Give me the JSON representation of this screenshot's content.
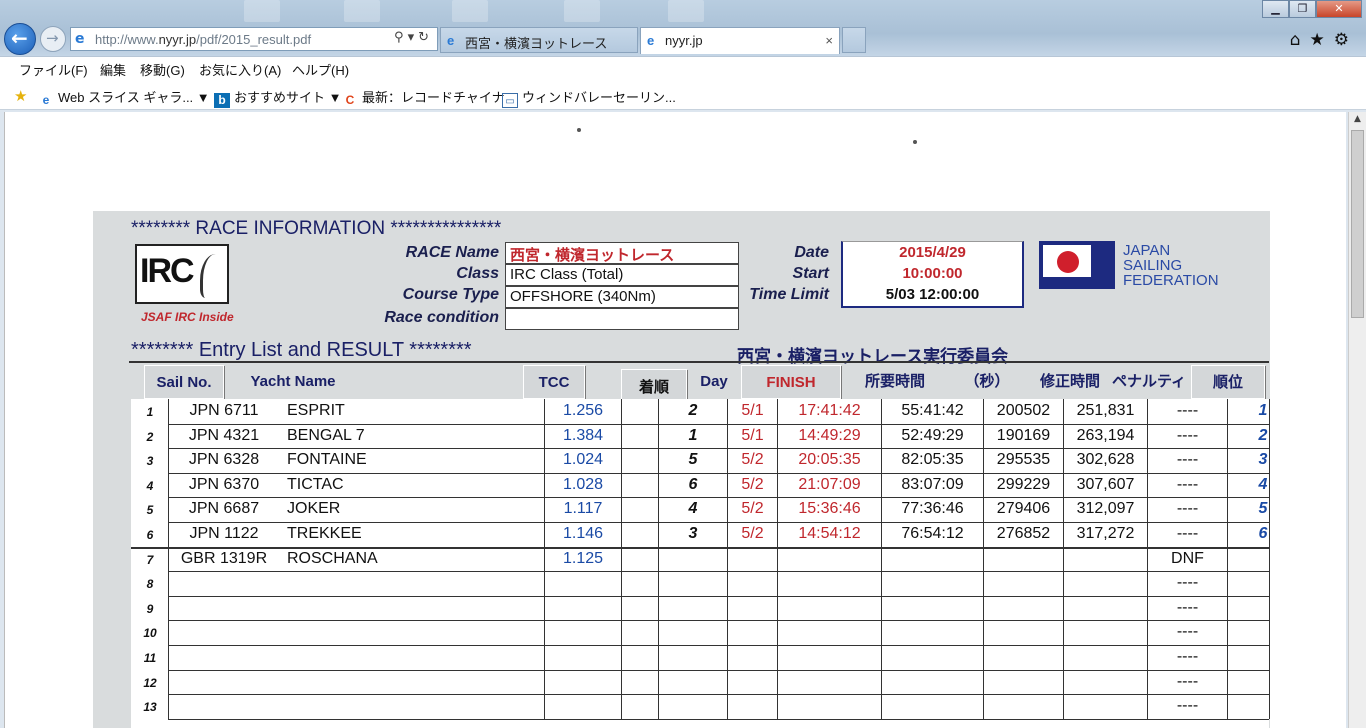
{
  "browser": {
    "address": {
      "prefix": "http://www.",
      "host": "nyyr.jp",
      "path": "/pdf/2015_result.pdf"
    },
    "tabs": [
      {
        "label": "西宮・横濱ヨットレース"
      },
      {
        "label": "nyyr.jp",
        "close": "×"
      }
    ],
    "menu": [
      "ファイル(F)",
      "編集",
      "移動(G)",
      "お気に入り(A)",
      "ヘルプ(H)"
    ],
    "favorites": [
      "Web スライス ギャラ...",
      "おすすめサイト",
      "最新：レコードチャイナ",
      "ウィンドバレーセーリン..."
    ]
  },
  "document": {
    "race_info_heading": "********  RACE INFORMATION  ***************",
    "irc_logo": "IRC",
    "jsaf_tagline": "JSAF IRC Inside",
    "labels": {
      "race_name": "RACE Name",
      "class": "Class",
      "course_type": "Course Type",
      "race_condition": "Race condition",
      "date": "Date",
      "start": "Start",
      "time_limit": "Time Limit"
    },
    "values": {
      "race_name": "西宮・横濱ヨットレース",
      "class": "IRC  Class (Total)",
      "course_type": "OFFSHORE (340Nm)",
      "race_condition": "",
      "date": "2015/4/29",
      "start": "10:00:00",
      "time_limit": "5/03 12:00:00"
    },
    "federation_lines": [
      "JAPAN",
      "SAILING",
      "FEDERATION"
    ],
    "entry_heading": "********  Entry List  and  RESULT  ********",
    "committee": "西宮・横濱ヨットレース実行委員会",
    "headers": {
      "sail_no": "Sail No.",
      "yacht_name": "Yacht Name",
      "tcc": "TCC",
      "finish_order": "着順",
      "day": "Day",
      "finish": "FINISH",
      "elapsed": "所要時間",
      "seconds": "（秒）",
      "corrected": "修正時間",
      "penalty": "ペナルティ",
      "rank": "順位"
    },
    "rows": [
      {
        "num": "1",
        "sail": "JPN 6711",
        "yacht": "ESPRIT",
        "tcc": "1.256",
        "order": "2",
        "day": "5/1",
        "finish": "17:41:42",
        "elapsed": "55:41:42",
        "sec": "200502",
        "corrected": "251,831",
        "penalty": "----",
        "rank": "1"
      },
      {
        "num": "2",
        "sail": "JPN 4321",
        "yacht": "BENGAL 7",
        "tcc": "1.384",
        "order": "1",
        "day": "5/1",
        "finish": "14:49:29",
        "elapsed": "52:49:29",
        "sec": "190169",
        "corrected": "263,194",
        "penalty": "----",
        "rank": "2"
      },
      {
        "num": "3",
        "sail": "JPN 6328",
        "yacht": "FONTAINE",
        "tcc": "1.024",
        "order": "5",
        "day": "5/2",
        "finish": "20:05:35",
        "elapsed": "82:05:35",
        "sec": "295535",
        "corrected": "302,628",
        "penalty": "----",
        "rank": "3"
      },
      {
        "num": "4",
        "sail": "JPN 6370",
        "yacht": "TICTAC",
        "tcc": "1.028",
        "order": "6",
        "day": "5/2",
        "finish": "21:07:09",
        "elapsed": "83:07:09",
        "sec": "299229",
        "corrected": "307,607",
        "penalty": "----",
        "rank": "4"
      },
      {
        "num": "5",
        "sail": "JPN 6687",
        "yacht": "JOKER",
        "tcc": "1.117",
        "order": "4",
        "day": "5/2",
        "finish": "15:36:46",
        "elapsed": "77:36:46",
        "sec": "279406",
        "corrected": "312,097",
        "penalty": "----",
        "rank": "5"
      },
      {
        "num": "6",
        "sail": "JPN 1122",
        "yacht": "TREKKEE",
        "tcc": "1.146",
        "order": "3",
        "day": "5/2",
        "finish": "14:54:12",
        "elapsed": "76:54:12",
        "sec": "276852",
        "corrected": "317,272",
        "penalty": "----",
        "rank": "6"
      },
      {
        "num": "7",
        "sail": "GBR 1319R",
        "yacht": "ROSCHANA",
        "tcc": "1.125",
        "order": "",
        "day": "",
        "finish": "",
        "elapsed": "",
        "sec": "",
        "corrected": "",
        "penalty": "DNF",
        "rank": ""
      },
      {
        "num": "8",
        "sail": "",
        "yacht": "",
        "tcc": "",
        "order": "",
        "day": "",
        "finish": "",
        "elapsed": "",
        "sec": "",
        "corrected": "",
        "penalty": "----",
        "rank": ""
      },
      {
        "num": "9",
        "sail": "",
        "yacht": "",
        "tcc": "",
        "order": "",
        "day": "",
        "finish": "",
        "elapsed": "",
        "sec": "",
        "corrected": "",
        "penalty": "----",
        "rank": ""
      },
      {
        "num": "10",
        "sail": "",
        "yacht": "",
        "tcc": "",
        "order": "",
        "day": "",
        "finish": "",
        "elapsed": "",
        "sec": "",
        "corrected": "",
        "penalty": "----",
        "rank": ""
      },
      {
        "num": "11",
        "sail": "",
        "yacht": "",
        "tcc": "",
        "order": "",
        "day": "",
        "finish": "",
        "elapsed": "",
        "sec": "",
        "corrected": "",
        "penalty": "----",
        "rank": ""
      },
      {
        "num": "12",
        "sail": "",
        "yacht": "",
        "tcc": "",
        "order": "",
        "day": "",
        "finish": "",
        "elapsed": "",
        "sec": "",
        "corrected": "",
        "penalty": "----",
        "rank": ""
      },
      {
        "num": "13",
        "sail": "",
        "yacht": "",
        "tcc": "",
        "order": "",
        "day": "",
        "finish": "",
        "elapsed": "",
        "sec": "",
        "corrected": "",
        "penalty": "----",
        "rank": ""
      }
    ]
  },
  "colors": {
    "heading_navy": "#1a2066",
    "red_text": "#c0272d",
    "tcc_blue": "#1a4aa5"
  }
}
